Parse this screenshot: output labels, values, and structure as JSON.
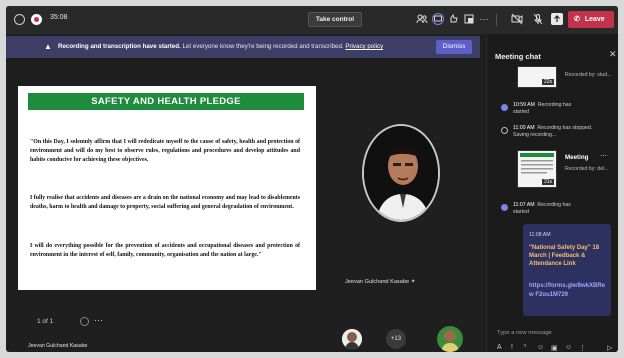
{
  "topbar": {
    "time": "35:08",
    "take_control": "Take control",
    "more": "⋯",
    "leave": "Leave"
  },
  "banner": {
    "bold": "Recording and transcription have started.",
    "text": "Let everyone know they're being recorded and transcribed.",
    "link": "Privacy policy",
    "dismiss": "Dismiss"
  },
  "slide": {
    "title": "SAFETY AND HEALTH PLEDGE",
    "p1": "\"On this Day, I solemnly affirm that I will rededicate myself to the cause of safety, health and protection of environment and will do my best to observe rules, regulations and procedures and develop attitudes and habits conducive for achieving these objectives.",
    "p2": "I fully realise that accidents and diseases are a drain on the national economy and may lead to disablements deaths, harm to health and damage to property, social suffering and general degradation of environment.",
    "p3": "I will do everything possible for the prevention of accidents and occupational diseases and protection of environment in the interest of self, family, community, organisation and the nation at large.\""
  },
  "presenter": {
    "name": "Jeevan Gulchand Kasabe"
  },
  "stage": {
    "page_counter": "1 of 1",
    "more": "⋯",
    "local_name": "Jeevan Gulchand Kasabe",
    "plus_count": "+13"
  },
  "chat": {
    "title": "Meeting chat",
    "rec_sub_top": "Recorded by: stud...",
    "thumb_badge_1": "22s",
    "ev1": {
      "time": "10:59 AM",
      "text": "Recording has started"
    },
    "ev2": {
      "time": "11:00 AM",
      "text": "Recording has stopped. Saving recording..."
    },
    "rec2": {
      "title": "Meeting",
      "sub": "Recorded by: del...",
      "badge": "31s",
      "more": "⋯"
    },
    "ev3": {
      "time": "11:07 AM",
      "text": "Recording has started"
    },
    "msg": {
      "time": "11:08 AM",
      "quote": "\"National Safety Day\" 18 March | Feedback & Attendance Link",
      "link": "https://forms.gle/8wkXBRew F2ou1M729"
    },
    "input_placeholder": "Type a new message"
  }
}
